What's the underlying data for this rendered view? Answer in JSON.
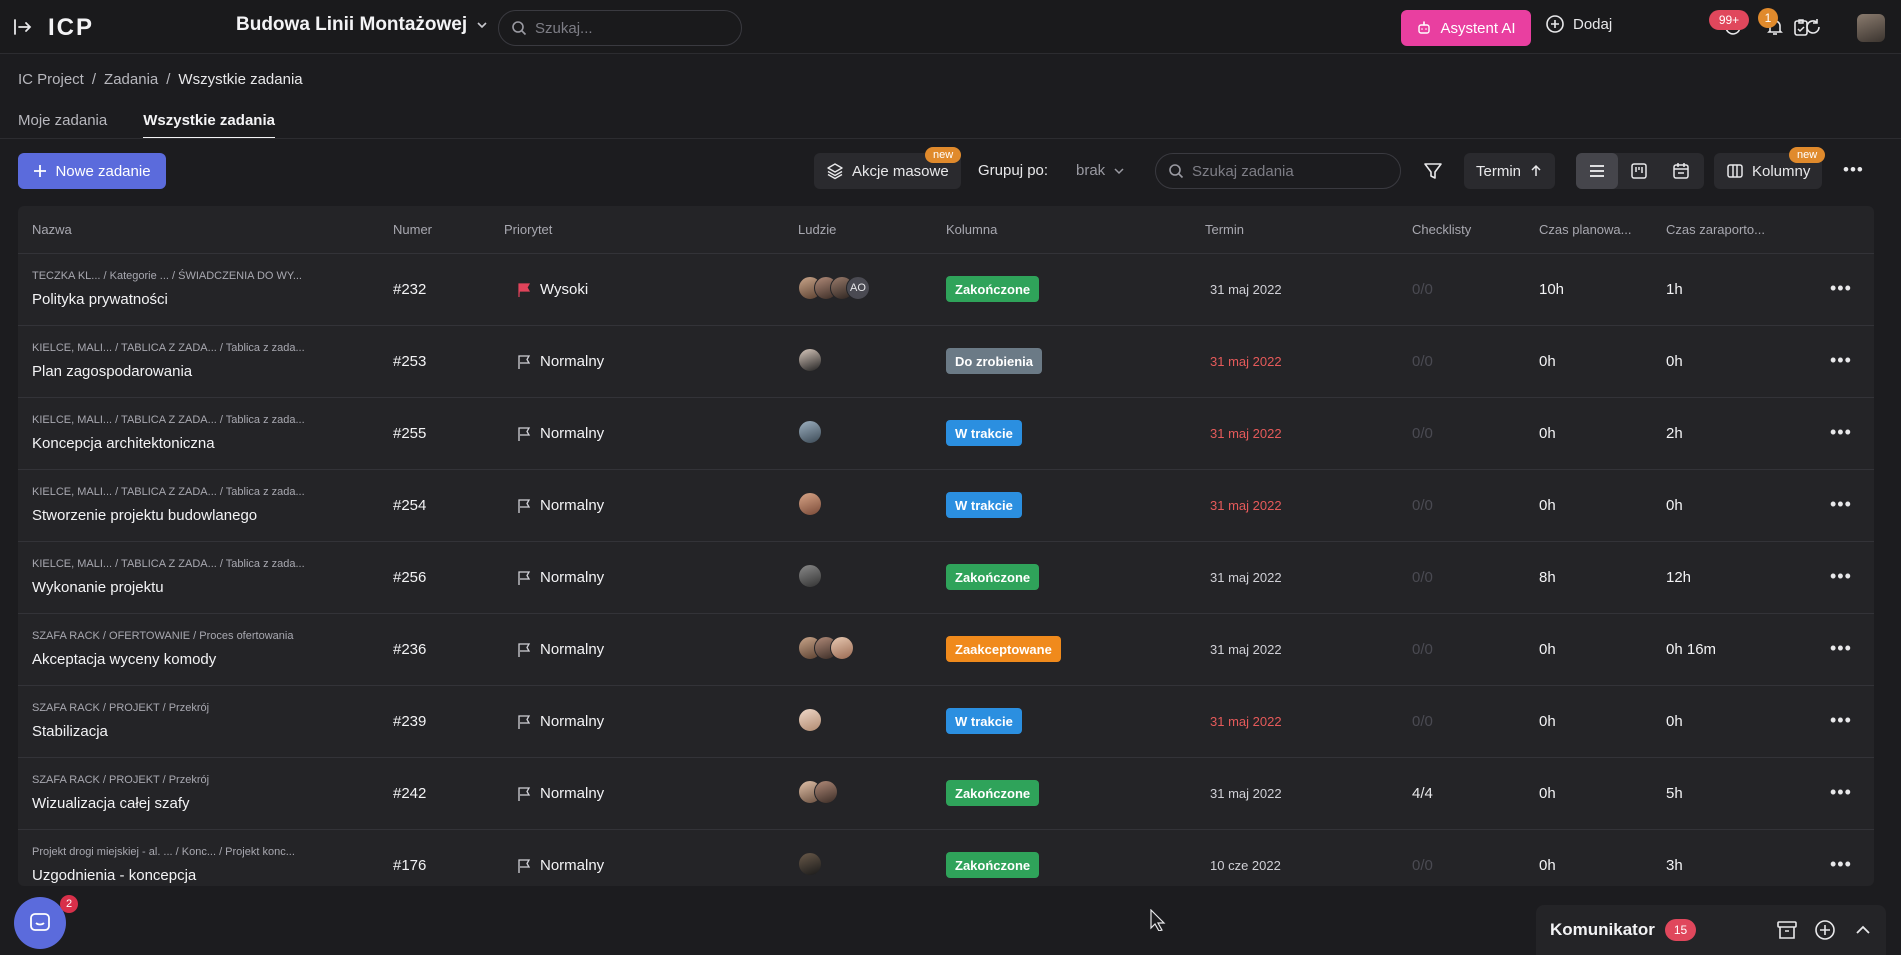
{
  "header": {
    "collapse_icon": "collapse-sidebar-icon",
    "logo_text": "ICP",
    "project_name": "Budowa Linii Montażowej",
    "search_placeholder": "Szukaj...",
    "ai_button": "Asystent AI",
    "add_button": "Dodaj",
    "notifications_badge": "99+",
    "updates_badge": "1"
  },
  "breadcrumb": {
    "root": "IC Project",
    "sep": "/",
    "section": "Zadania",
    "current": "Wszystkie zadania"
  },
  "tabs": [
    {
      "label": "Moje zadania",
      "active": false
    },
    {
      "label": "Wszystkie zadania",
      "active": true
    }
  ],
  "toolbar": {
    "new_task": "Nowe zadanie",
    "bulk_actions": "Akcje masowe",
    "new_tag": "new",
    "group_by_label": "Grupuj po:",
    "group_by_value": "brak",
    "search_placeholder": "Szukaj zadania",
    "sort_label": "Termin",
    "columns_label": "Kolumny",
    "columns_new_tag": "new",
    "more": "•••"
  },
  "table": {
    "columns": [
      "Nazwa",
      "Numer",
      "Priorytet",
      "Ludzie",
      "Kolumna",
      "Termin",
      "Checklisty",
      "Czas planowa...",
      "Czas zaraporto..."
    ],
    "rows": [
      {
        "path": "TECZKA KL...  / Kategorie ...  / ŚWIADCZENIA DO WY...",
        "name": "Polityka prywatności",
        "number": "#232",
        "priority": "Wysoki",
        "priority_high": true,
        "people": [
          "p1",
          "p2",
          "p3",
          "AO"
        ],
        "status": "Zakończone",
        "status_color": "#2fa35a",
        "due": "31 maj 2022",
        "overdue": false,
        "checklist": "0/0",
        "checklist_done": false,
        "planned": "10h",
        "reported": "1h"
      },
      {
        "path": "KIELCE, MALI...  / TABLICA Z ZADA...  / Tablica z zada...",
        "name": "Plan zagospodarowania",
        "number": "#253",
        "priority": "Normalny",
        "priority_high": false,
        "people": [
          "p4"
        ],
        "status": "Do zrobienia",
        "status_color": "#6b7a86",
        "due": "31 maj 2022",
        "overdue": true,
        "checklist": "0/0",
        "checklist_done": false,
        "planned": "0h",
        "reported": "0h"
      },
      {
        "path": "KIELCE, MALI...  / TABLICA Z ZADA...  / Tablica z zada...",
        "name": "Koncepcja architektoniczna",
        "number": "#255",
        "priority": "Normalny",
        "priority_high": false,
        "people": [
          "p5"
        ],
        "status": "W trakcie",
        "status_color": "#2b8fe0",
        "due": "31 maj 2022",
        "overdue": true,
        "checklist": "0/0",
        "checklist_done": false,
        "planned": "0h",
        "reported": "2h"
      },
      {
        "path": "KIELCE, MALI...  / TABLICA Z ZADA...  / Tablica z zada...",
        "name": "Stworzenie projektu budowlanego",
        "number": "#254",
        "priority": "Normalny",
        "priority_high": false,
        "people": [
          "p6"
        ],
        "status": "W trakcie",
        "status_color": "#2b8fe0",
        "due": "31 maj 2022",
        "overdue": true,
        "checklist": "0/0",
        "checklist_done": false,
        "planned": "0h",
        "reported": "0h"
      },
      {
        "path": "KIELCE, MALI...  / TABLICA Z ZADA...  / Tablica z zada...",
        "name": "Wykonanie projektu",
        "number": "#256",
        "priority": "Normalny",
        "priority_high": false,
        "people": [
          "p7"
        ],
        "status": "Zakończone",
        "status_color": "#2fa35a",
        "due": "31 maj 2022",
        "overdue": false,
        "checklist": "0/0",
        "checklist_done": false,
        "planned": "8h",
        "reported": "12h"
      },
      {
        "path": "SZAFA RACK / OFERTOWANIE / Proces ofertowania",
        "name": "Akceptacja wyceny komody",
        "number": "#236",
        "priority": "Normalny",
        "priority_high": false,
        "people": [
          "p1",
          "p2",
          "p8"
        ],
        "status": "Zaakceptowane",
        "status_color": "#f08a1c",
        "due": "31 maj 2022",
        "overdue": false,
        "checklist": "0/0",
        "checklist_done": false,
        "planned": "0h",
        "reported": "0h 16m"
      },
      {
        "path": "SZAFA RACK / PROJEKT / Przekrój",
        "name": "Stabilizacja",
        "number": "#239",
        "priority": "Normalny",
        "priority_high": false,
        "people": [
          "p9"
        ],
        "status": "W trakcie",
        "status_color": "#2b8fe0",
        "due": "31 maj 2022",
        "overdue": true,
        "checklist": "0/0",
        "checklist_done": false,
        "planned": "0h",
        "reported": "0h"
      },
      {
        "path": "SZAFA RACK / PROJEKT / Przekrój",
        "name": "Wizualizacja całej szafy",
        "number": "#242",
        "priority": "Normalny",
        "priority_high": false,
        "people": [
          "p10",
          "p2"
        ],
        "status": "Zakończone",
        "status_color": "#2fa35a",
        "due": "31 maj 2022",
        "overdue": false,
        "checklist": "4/4",
        "checklist_done": true,
        "planned": "0h",
        "reported": "5h"
      },
      {
        "path": "Projekt drogi miejskiej - al. ...  / Konc...  / Projekt konc...",
        "name": "Uzgodnienia - koncepcja",
        "number": "#176",
        "priority": "Normalny",
        "priority_high": false,
        "people": [
          "p11"
        ],
        "status": "Zakończone",
        "status_color": "#2fa35a",
        "due": "10 cze 2022",
        "overdue": false,
        "checklist": "0/0",
        "checklist_done": false,
        "planned": "0h",
        "reported": "3h"
      }
    ]
  },
  "chat": {
    "badge": "2"
  },
  "komunikator": {
    "title": "Komunikator",
    "badge": "15"
  }
}
